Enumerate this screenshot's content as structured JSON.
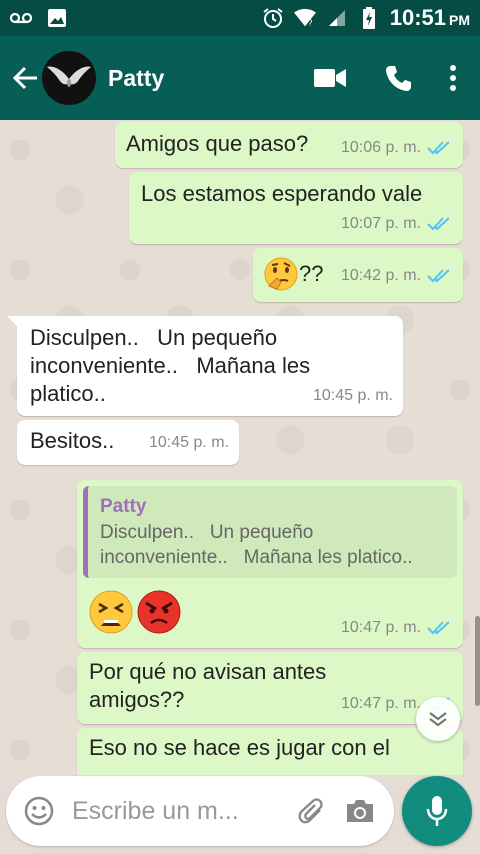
{
  "status_bar": {
    "time": "10:51",
    "ampm": "PM",
    "icons": [
      "voicemail-icon",
      "image-icon",
      "alarm-icon",
      "wifi-icon",
      "signal-icon",
      "battery-charging-icon"
    ]
  },
  "header": {
    "contact_name": "Patty",
    "icons": [
      "back-arrow-icon",
      "avatar",
      "video-call-icon",
      "phone-icon",
      "more-vert-icon"
    ]
  },
  "messages": [
    {
      "dir": "out",
      "text": "Amigos que paso?",
      "time": "10:06 p. m.",
      "read": true
    },
    {
      "dir": "out",
      "text": "Los estamos esperando vale",
      "time": "10:07 p. m.",
      "read": true
    },
    {
      "dir": "out",
      "text": "??",
      "emoji": "thinking-face",
      "time": "10:42 p. m.",
      "read": true
    },
    {
      "dir": "in",
      "text": "Disculpen..   Un pequeño\ninconveniente..   Mañana les\nplatico..",
      "time": "10:45 p. m."
    },
    {
      "dir": "in",
      "text": "Besitos..",
      "time": "10:45 p. m."
    },
    {
      "dir": "out",
      "quote_name": "Patty",
      "quote_text": "Disculpen..   Un pequeño\ninconveniente..   Mañana les platico..",
      "emojis": [
        "tired-face",
        "angry-face"
      ],
      "time": "10:47 p. m.",
      "read": true
    },
    {
      "dir": "out",
      "text": "Por qué no avisan antes\namigos??",
      "time": "10:47 p. m.",
      "read": true
    },
    {
      "dir": "out",
      "text": "Eso no se hace es jugar con el"
    }
  ],
  "composer": {
    "placeholder": "Escribe un m..."
  },
  "colors": {
    "header": "#075e54",
    "status_bar": "#054d44",
    "outgoing_bubble": "#dcf8c6",
    "incoming_bubble": "#ffffff",
    "read_ticks": "#4fc3f7",
    "quote_accent": "#a26fba",
    "mic_button": "#128c7e"
  }
}
